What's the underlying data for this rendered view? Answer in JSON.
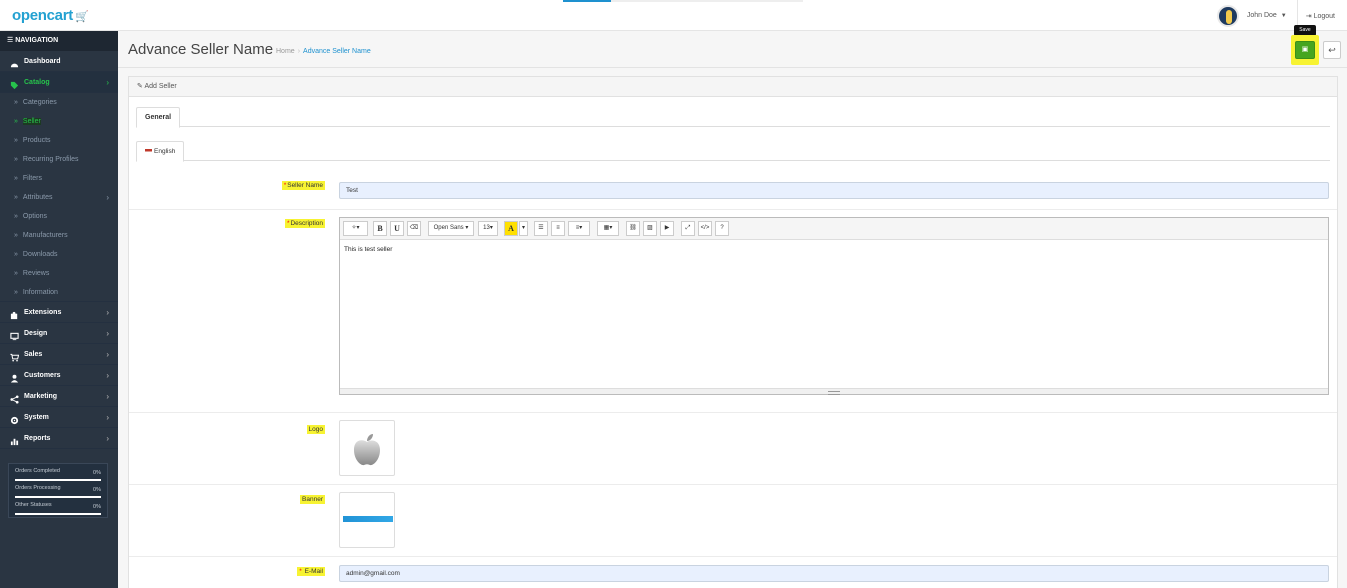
{
  "header": {
    "logo_text": "opencart",
    "user_name": "John Doe",
    "logout_label": "Logout"
  },
  "sidebar": {
    "nav_title": "NAVIGATION",
    "items": [
      {
        "label": "Dashboard"
      },
      {
        "label": "Catalog"
      },
      {
        "label": "Extensions"
      },
      {
        "label": "Design"
      },
      {
        "label": "Sales"
      },
      {
        "label": "Customers"
      },
      {
        "label": "Marketing"
      },
      {
        "label": "System"
      },
      {
        "label": "Reports"
      }
    ],
    "catalog_sub": [
      {
        "label": "Categories"
      },
      {
        "label": "Seller"
      },
      {
        "label": "Products"
      },
      {
        "label": "Recurring Profiles"
      },
      {
        "label": "Filters"
      },
      {
        "label": "Attributes"
      },
      {
        "label": "Options"
      },
      {
        "label": "Manufacturers"
      },
      {
        "label": "Downloads"
      },
      {
        "label": "Reviews"
      },
      {
        "label": "Information"
      }
    ],
    "stats": [
      {
        "label": "Orders Completed",
        "value": "0%"
      },
      {
        "label": "Orders Processing",
        "value": "0%"
      },
      {
        "label": "Other Statuses",
        "value": "0%"
      }
    ]
  },
  "page": {
    "title": "Advance Seller Name",
    "breadcrumb_home": "Home",
    "breadcrumb_current": "Advance Seller Name",
    "save_tooltip": "Save",
    "panel_title": "Add Seller",
    "tab_general": "General",
    "tab_language": "English"
  },
  "form": {
    "seller_name_label": "Seller Name",
    "seller_name_value": "Test",
    "description_label": "Description",
    "description_text": "This is test seller",
    "logo_label": "Logo",
    "banner_label": "Banner",
    "email_label": "E-Mail",
    "email_value": "admin@gmail.com",
    "required_mark": "*"
  },
  "editor_toolbar": {
    "font_name": "Open Sans",
    "font_size": "13"
  },
  "colors": {
    "accent_blue": "#1e91cf",
    "active_green": "#27c24c",
    "save_green": "#46a51f",
    "highlight_yellow": "#f7f332",
    "sidebar_bg": "#2a3542"
  }
}
